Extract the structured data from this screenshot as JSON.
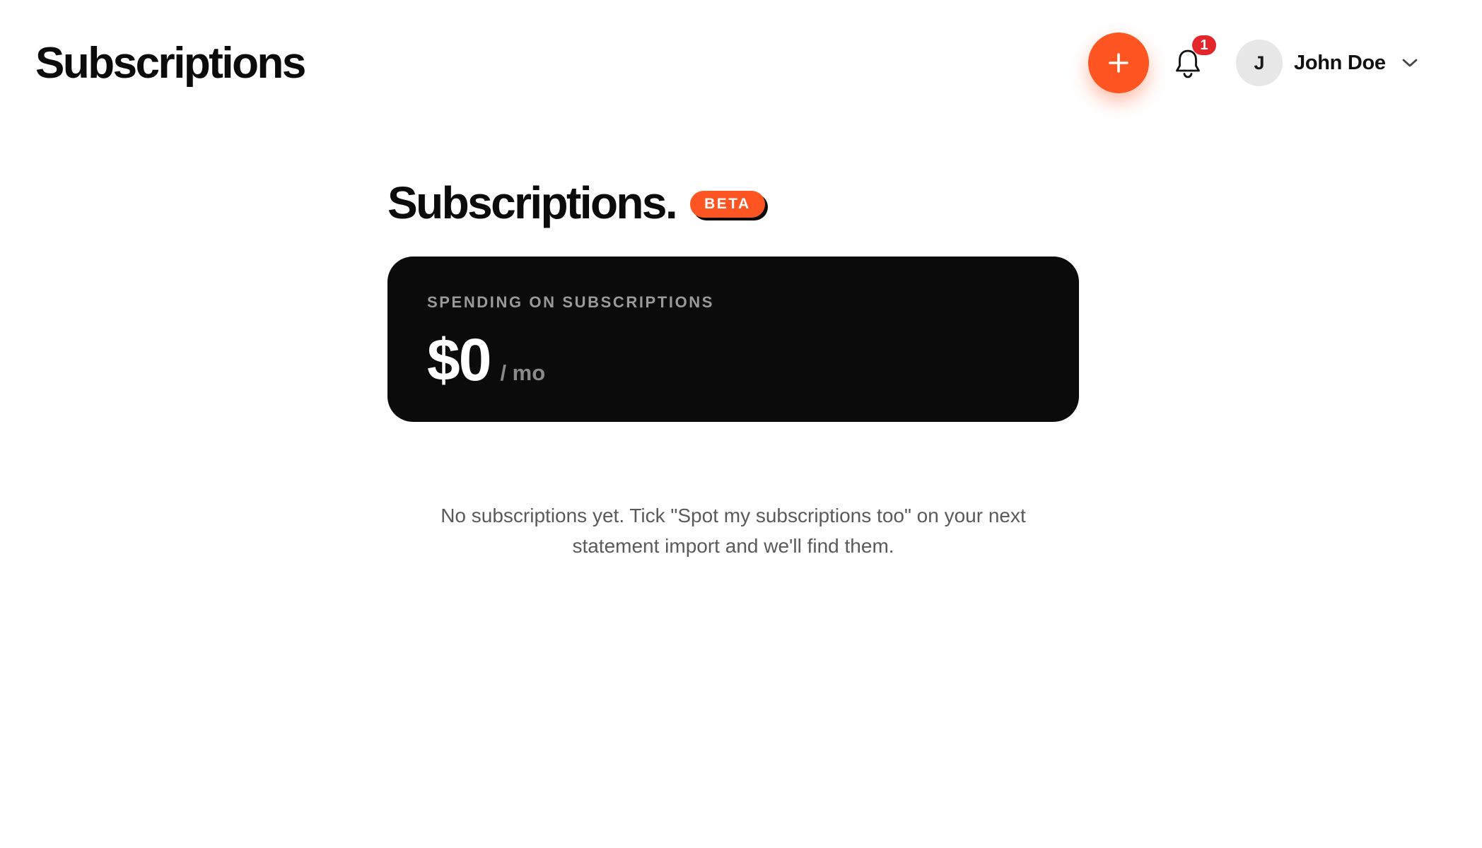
{
  "header": {
    "title": "Subscriptions",
    "add_icon": "plus-icon",
    "notifications": {
      "icon": "bell-icon",
      "count": "1"
    },
    "user": {
      "initial": "J",
      "name": "John Doe",
      "menu_icon": "chevron-down-icon"
    }
  },
  "main": {
    "title": "Subscriptions.",
    "badge": "BETA",
    "spending_card": {
      "label": "SPENDING ON SUBSCRIPTIONS",
      "amount": "$0",
      "period": "/ mo"
    },
    "empty_state": "No subscriptions yet. Tick \"Spot my subscriptions too\" on your next statement import and we'll find them."
  },
  "colors": {
    "accent": "#ff5522",
    "badge_red": "#e3262c",
    "card_background": "#0b0b0b",
    "text_primary": "#0b0b0b",
    "text_muted": "#5a5a5a"
  }
}
